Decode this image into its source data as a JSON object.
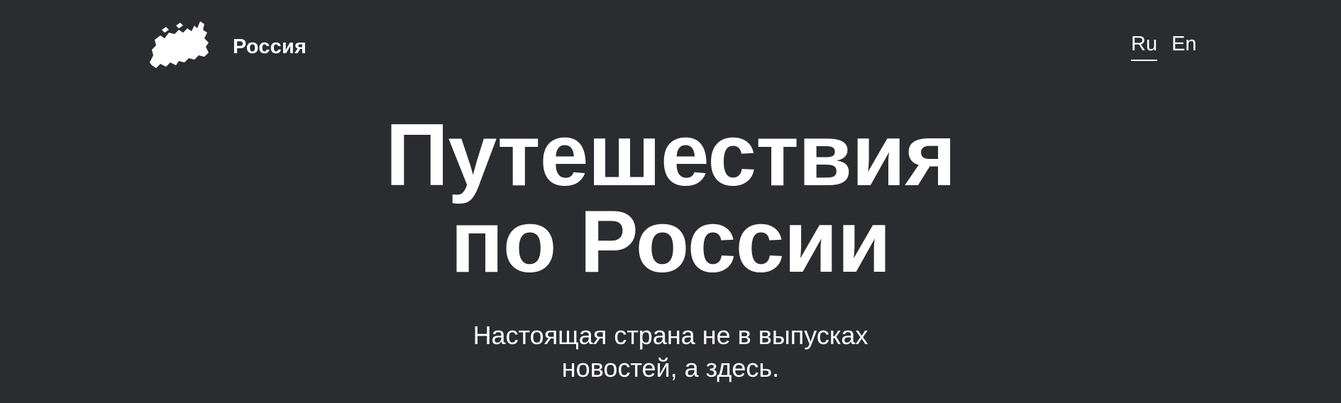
{
  "header": {
    "logo": {
      "icon": "russia-map-icon",
      "text": "Россия"
    },
    "languages": [
      {
        "label": "Ru",
        "active": true
      },
      {
        "label": "En",
        "active": false
      }
    ]
  },
  "hero": {
    "title_line1": "Путешествия",
    "title_line2": "по России",
    "subtitle": "Настоящая страна не в выпусках новостей, а здесь."
  },
  "colors": {
    "background": "#2b2c30",
    "text": "#ffffff"
  }
}
